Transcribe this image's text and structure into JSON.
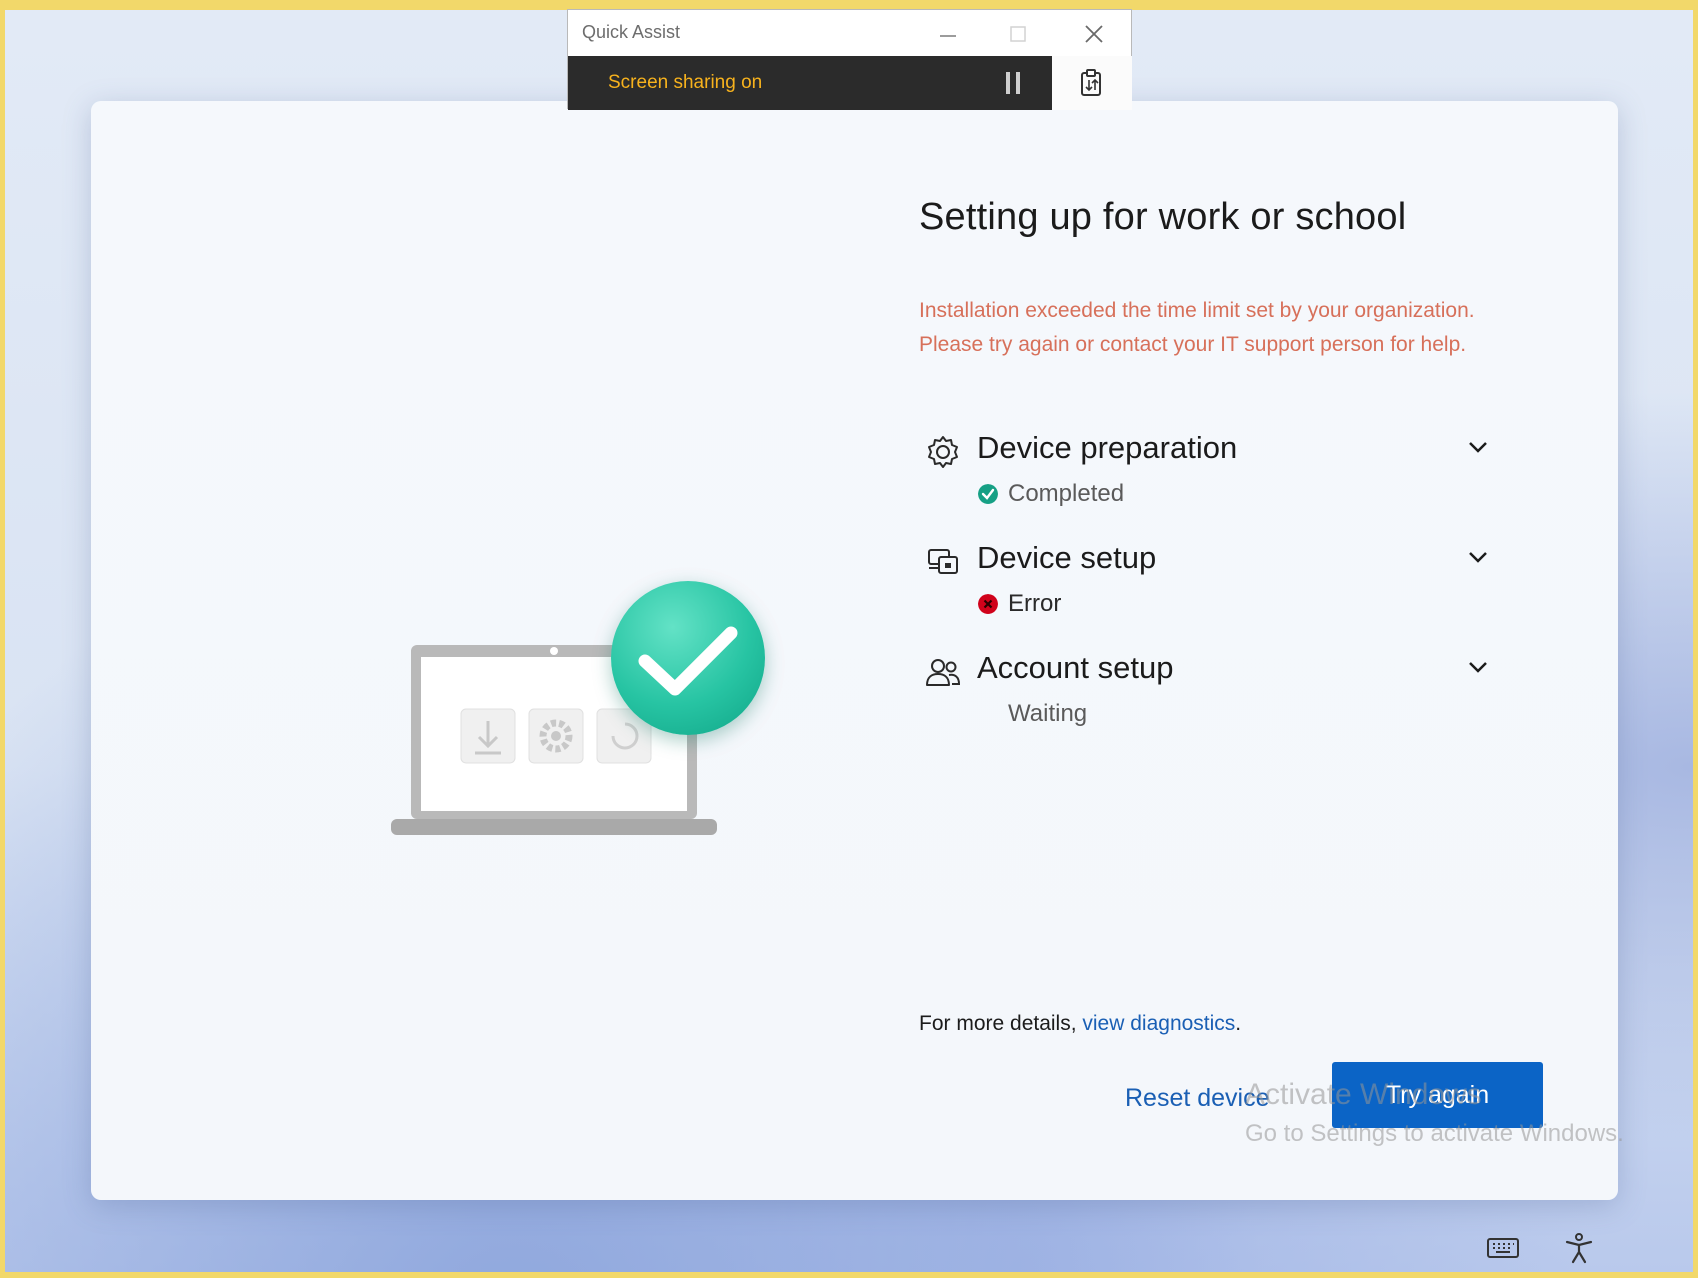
{
  "quick_assist": {
    "title": "Quick Assist",
    "status_text": "Screen sharing on",
    "status_color": "#f7b21d",
    "pause_icon": "pause-icon",
    "clipboard_icon": "clipboard-transfer-icon"
  },
  "setup": {
    "title": "Setting up for work or school",
    "error_line1": "Installation exceeded the time limit set by your organization.",
    "error_line2": "Please try again or contact your IT support person for help.",
    "error_color": "#d7705a",
    "steps": [
      {
        "icon": "gear-icon",
        "name": "Device preparation",
        "status": "Completed",
        "status_icon": "success-check-icon",
        "status_color": "#16a085"
      },
      {
        "icon": "device-setup-icon",
        "name": "Device setup",
        "status": "Error",
        "status_icon": "error-icon",
        "status_color": "#d0021b"
      },
      {
        "icon": "people-icon",
        "name": "Account setup",
        "status": "Waiting"
      }
    ],
    "details_prefix": "For more details, ",
    "details_link": "view diagnostics",
    "details_suffix": ".",
    "reset_label": "Reset device",
    "try_again_label": "Try again",
    "accent_color": "#0b64c6"
  },
  "watermark": {
    "line1": "Activate Windows",
    "line2": "Go to Settings to activate Windows."
  },
  "tray": {
    "keyboard_icon": "keyboard-icon",
    "accessibility_icon": "accessibility-icon"
  }
}
